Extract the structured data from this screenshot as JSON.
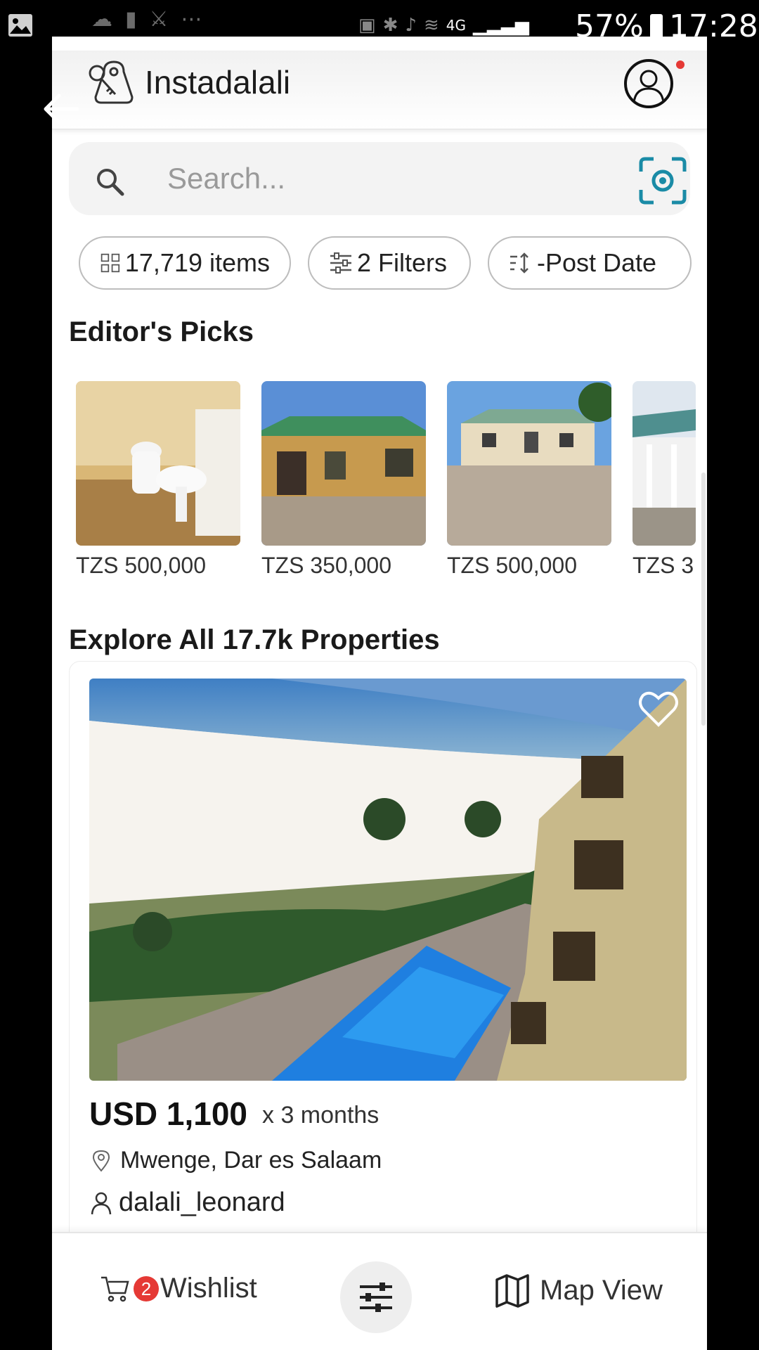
{
  "status_bar": {
    "battery": "57%",
    "time": "17:28",
    "network": "4G"
  },
  "app": {
    "title": "Instadalali"
  },
  "search": {
    "placeholder": "Search..."
  },
  "chips": [
    {
      "label": "17,719 items",
      "icon": "grid-icon"
    },
    {
      "label": "2 Filters",
      "icon": "sliders-icon"
    },
    {
      "label": "-Post Date",
      "icon": "sort-icon"
    }
  ],
  "editors_picks": {
    "title": "Editor's Picks",
    "items": [
      {
        "price": "TZS 500,000",
        "image": "bathroom photo"
      },
      {
        "price": "TZS 350,000",
        "image": "house with green roof"
      },
      {
        "price": "TZS 500,000",
        "image": "house with paved yard"
      },
      {
        "price": "TZS 3",
        "image": "white building with porch"
      }
    ]
  },
  "explore": {
    "title": "Explore All 17.7k Properties",
    "card": {
      "price": "USD 1,100",
      "period": "x 3 months",
      "location": "Mwenge, Dar es Salaam",
      "agent": "dalali_leonard"
    }
  },
  "bottom_bar": {
    "wishlist_label": "Wishlist",
    "wishlist_count": "2",
    "map_label": "Map View"
  },
  "colors": {
    "accent_red": "#e53935",
    "camera_teal": "#1a8ba6"
  }
}
